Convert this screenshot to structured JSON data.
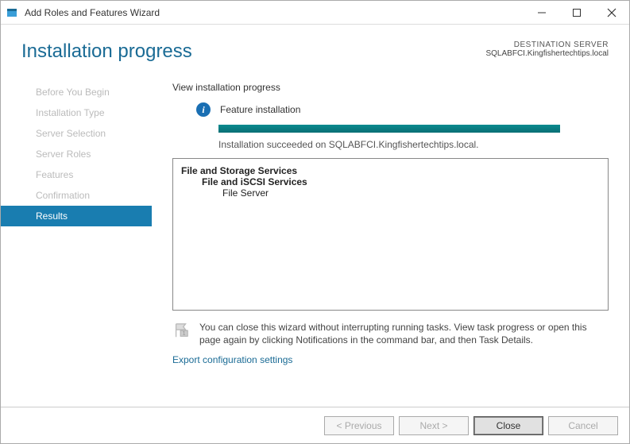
{
  "title": "Add Roles and Features Wizard",
  "dest_label": "DESTINATION SERVER",
  "dest_name": "SQLABFCI.Kingfishertechtips.local",
  "page_heading": "Installation progress",
  "sidebar": {
    "items": [
      {
        "label": "Before You Begin"
      },
      {
        "label": "Installation Type"
      },
      {
        "label": "Server Selection"
      },
      {
        "label": "Server Roles"
      },
      {
        "label": "Features"
      },
      {
        "label": "Confirmation"
      },
      {
        "label": "Results"
      }
    ],
    "active_index": 6
  },
  "content": {
    "instruction": "View installation progress",
    "status": "Feature installation",
    "success_msg": "Installation succeeded on SQLABFCI.Kingfishertechtips.local.",
    "results": {
      "l1": "File and Storage Services",
      "l2": "File and iSCSI Services",
      "l3": "File Server"
    },
    "note": "You can close this wizard without interrupting running tasks. View task progress or open this page again by clicking Notifications in the command bar, and then Task Details.",
    "export_link": "Export configuration settings"
  },
  "footer": {
    "prev": "< Previous",
    "next": "Next >",
    "close": "Close",
    "cancel": "Cancel"
  }
}
